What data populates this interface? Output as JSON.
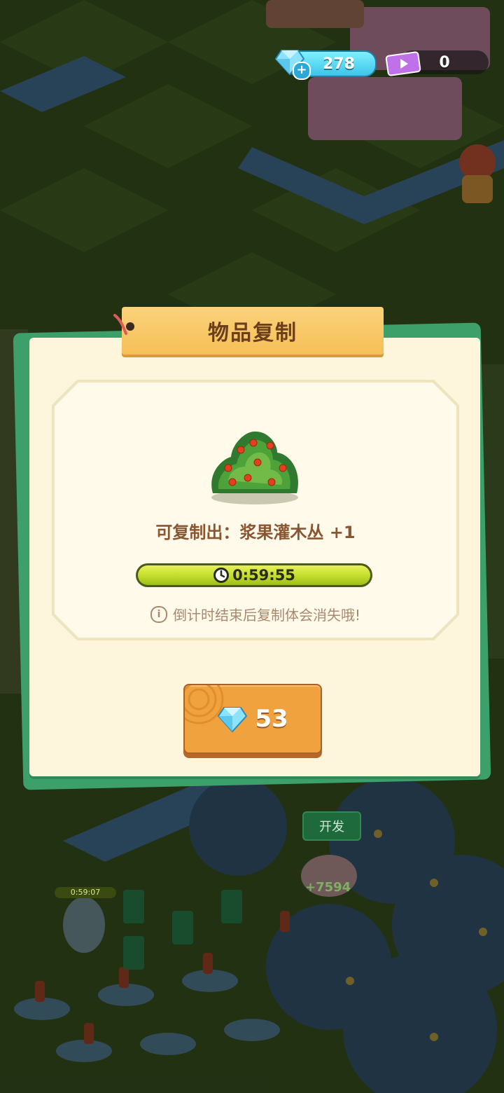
{
  "hud": {
    "gems": "278",
    "tickets": "0"
  },
  "dialog": {
    "title": "物品复制",
    "item_name_line": "可复制出：浆果灌木丛  +1",
    "timer": "0:59:55",
    "timer_progress": 1.0,
    "warning": "倒计时结束后复制体会消失哦!",
    "price": "53"
  },
  "background": {
    "develop_label": "开发",
    "timer_small": "0:59:07",
    "score": "+7594"
  },
  "colors": {
    "panel": "#fdf6dc",
    "panel_back": "#3da06a",
    "title_tab": "#f5bf57",
    "button": "#f0a23e",
    "progress_fill": "#c2dc2a",
    "text_brown": "#8a5632"
  },
  "icons": [
    "gem-icon",
    "plus-icon",
    "ticket-icon",
    "pin-icon",
    "berry-bush-icon",
    "clock-icon",
    "info-icon"
  ]
}
